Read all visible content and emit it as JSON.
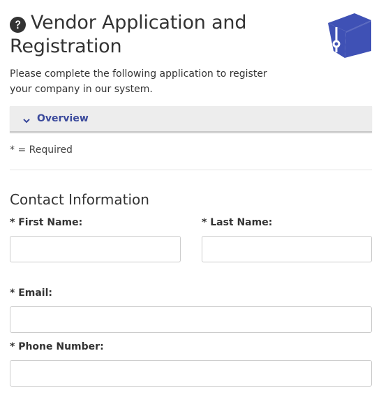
{
  "header": {
    "title_line1": "Vendor Application and",
    "title_line2": "Registration",
    "subtitle": "Please complete the following application to register your company in our system.",
    "help_icon": "question-circle-icon",
    "logo_icon": "graduation-cap-icon"
  },
  "accordion": {
    "label": "Overview",
    "icon": "chevron-down-icon"
  },
  "required_note": "* = Required",
  "contact": {
    "section_title": "Contact Information",
    "first_name_label": "* First Name:",
    "last_name_label": "* Last Name:",
    "email_label": "* Email:",
    "phone_label": "* Phone Number:",
    "first_name_value": "",
    "last_name_value": "",
    "email_value": "",
    "phone_value": ""
  },
  "colors": {
    "accent": "#3b4a9c",
    "logo": "#3f51b5",
    "text": "#333333",
    "accordion_bg": "#ededed"
  }
}
